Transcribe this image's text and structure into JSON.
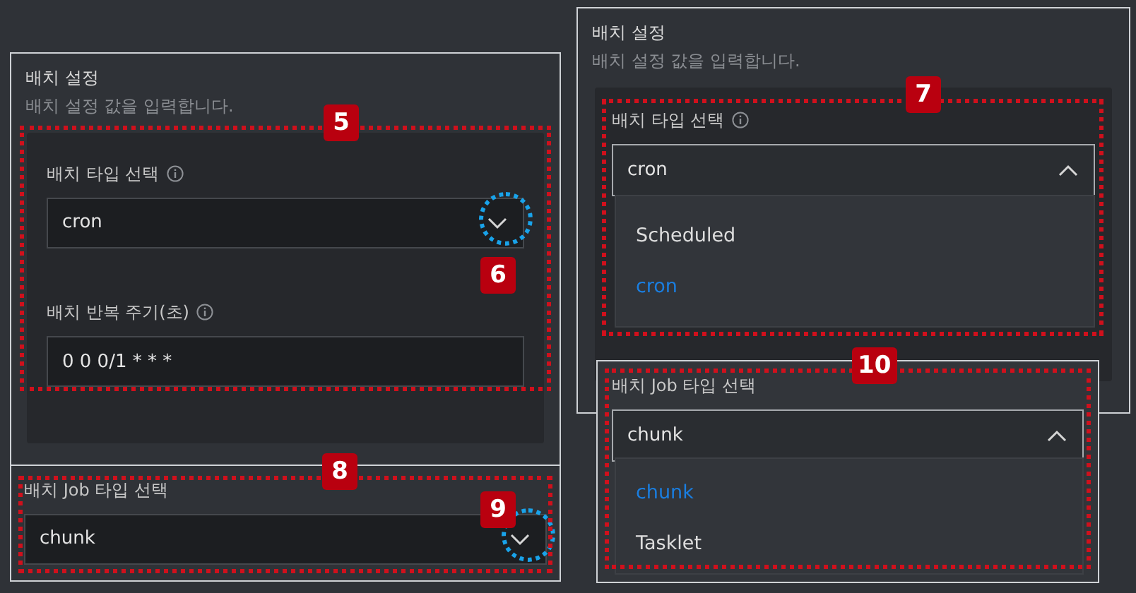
{
  "left": {
    "title": "배치 설정",
    "description": "배치 설정 값을 입력합니다.",
    "frame_badge": "5",
    "fields": [
      {
        "kind": "select",
        "label": "배치 타입 선택",
        "info": true,
        "value": "cron",
        "expanded": false,
        "callout": "6"
      },
      {
        "kind": "text",
        "label": "배치 반복 주기(초)",
        "info": true,
        "value": "0 0 0/1 * * *"
      }
    ],
    "job": {
      "frame_badge": "8",
      "label": "배치 Job 타입 선택",
      "value": "chunk",
      "expanded": false,
      "callout": "9"
    }
  },
  "right": {
    "title": "배치 설정",
    "description": "배치 설정 값을 입력합니다.",
    "frame_badge": "7",
    "field": {
      "label": "배치 타입 선택",
      "info": true,
      "value": "cron",
      "expanded": true,
      "options": [
        {
          "label": "Scheduled",
          "selected": false
        },
        {
          "label": "cron",
          "selected": true
        }
      ]
    },
    "job": {
      "frame_badge": "10",
      "label": "배치 Job 타입 선택",
      "value": "chunk",
      "expanded": true,
      "options": [
        {
          "label": "chunk",
          "selected": true
        },
        {
          "label": "Tasklet",
          "selected": false
        }
      ]
    }
  }
}
